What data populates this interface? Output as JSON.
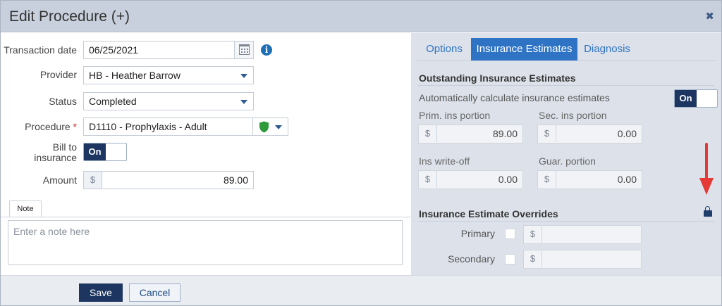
{
  "dialog": {
    "title": "Edit Procedure (+)",
    "close_symbol": "✖"
  },
  "form": {
    "transaction_date": {
      "label": "Transaction date",
      "value": "06/25/2021"
    },
    "provider": {
      "label": "Provider",
      "value": "HB - Heather Barrow"
    },
    "status": {
      "label": "Status",
      "value": "Completed"
    },
    "procedure": {
      "label": "Procedure",
      "required_mark": "*",
      "value": "D1110 - Prophylaxis - Adult"
    },
    "bill_to_insurance": {
      "label_line1": "Bill to",
      "label_line2": "insurance",
      "toggle": "On"
    },
    "amount": {
      "label": "Amount",
      "prefix": "$",
      "value": "89.00"
    },
    "note": {
      "tab_label": "Note",
      "placeholder": "Enter a note here"
    }
  },
  "tabs": [
    {
      "label": "Options",
      "active": false
    },
    {
      "label": "Insurance Estimates",
      "active": true
    },
    {
      "label": "Diagnosis",
      "active": false
    }
  ],
  "outstanding": {
    "title": "Outstanding Insurance Estimates",
    "auto_calc_label": "Automatically calculate insurance estimates",
    "auto_calc_toggle": "On",
    "prim_label": "Prim. ins portion",
    "prim_value": "89.00",
    "sec_label": "Sec. ins portion",
    "sec_value": "0.00",
    "writeoff_label": "Ins write-off",
    "writeoff_value": "0.00",
    "guar_label": "Guar. portion",
    "guar_value": "0.00",
    "currency": "$"
  },
  "overrides": {
    "title": "Insurance Estimate Overrides",
    "primary_label": "Primary",
    "secondary_label": "Secondary",
    "currency": "$"
  },
  "footer": {
    "save_label": "Save",
    "cancel_label": "Cancel"
  },
  "colors": {
    "accent": "#2f74c4",
    "dark_navy": "#1c3661",
    "annotation_arrow": "#e53935",
    "shield": "#2e9a3a"
  },
  "icons": [
    "close-icon",
    "calendar-icon",
    "info-icon",
    "chevron-down-icon",
    "shield-icon",
    "lock-icon",
    "annotation-arrow"
  ]
}
